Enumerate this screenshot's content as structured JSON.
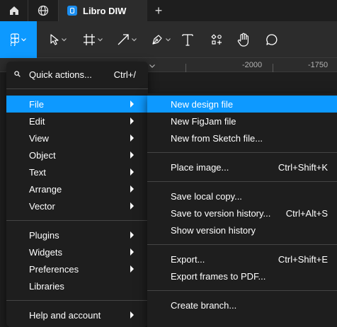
{
  "tabs": {
    "file_title": "Libro DIW",
    "add_label": "+"
  },
  "ruler": {
    "labels": [
      "-2000",
      "-1750"
    ]
  },
  "main_menu": {
    "quick_actions": {
      "label": "Quick actions...",
      "shortcut": "Ctrl+/"
    },
    "items": [
      {
        "label": "File",
        "submenu": true,
        "highlighted": true
      },
      {
        "label": "Edit",
        "submenu": true
      },
      {
        "label": "View",
        "submenu": true
      },
      {
        "label": "Object",
        "submenu": true
      },
      {
        "label": "Text",
        "submenu": true
      },
      {
        "label": "Arrange",
        "submenu": true
      },
      {
        "label": "Vector",
        "submenu": true
      },
      {
        "label": "Plugins",
        "submenu": true
      },
      {
        "label": "Widgets",
        "submenu": true
      },
      {
        "label": "Preferences",
        "submenu": true
      },
      {
        "label": "Libraries",
        "submenu": false
      },
      {
        "label": "Help and account",
        "submenu": true
      }
    ]
  },
  "file_menu": {
    "items": [
      {
        "label": "New design file",
        "shortcut": "",
        "highlighted": true
      },
      {
        "label": "New FigJam file",
        "shortcut": ""
      },
      {
        "label": "New from Sketch file...",
        "shortcut": ""
      },
      {
        "label": "Place image...",
        "shortcut": "Ctrl+Shift+K"
      },
      {
        "label": "Save local copy...",
        "shortcut": ""
      },
      {
        "label": "Save to version history...",
        "shortcut": "Ctrl+Alt+S"
      },
      {
        "label": "Show version history",
        "shortcut": ""
      },
      {
        "label": "Export...",
        "shortcut": "Ctrl+Shift+E"
      },
      {
        "label": "Export frames to PDF...",
        "shortcut": ""
      },
      {
        "label": "Create branch...",
        "shortcut": ""
      }
    ]
  },
  "colors": {
    "accent": "#0d99ff",
    "menu_bg": "#1e1e1e",
    "toolbar_bg": "#2c2c2c"
  }
}
